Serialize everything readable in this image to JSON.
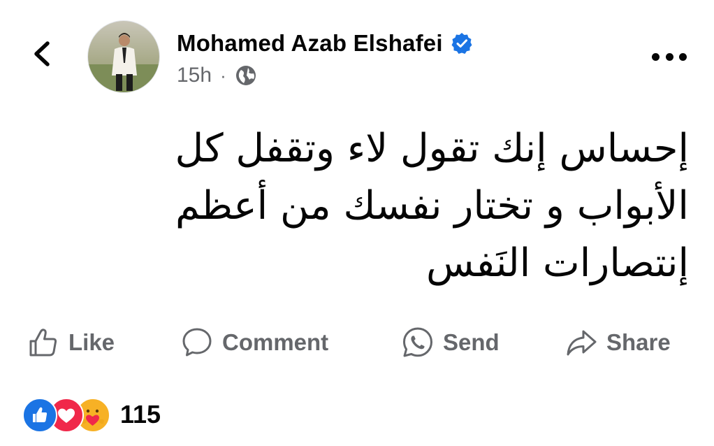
{
  "header": {
    "back_icon": "chevron-left-icon",
    "author_name": "Mohamed Azab Elshafei",
    "verified_icon": "verified-badge-icon",
    "time": "15h",
    "separator": "·",
    "privacy_icon": "globe-icon",
    "more_icon": "more-horizontal-icon"
  },
  "post": {
    "lines": [
      "إحساس إنك تقول لاء وتقفل كل",
      "الأبواب و تختار نفسك من أعظم",
      "إنتصارات النَفس"
    ]
  },
  "actions": [
    {
      "label": "Like",
      "icon": "thumbs-up-icon"
    },
    {
      "label": "Comment",
      "icon": "comment-bubble-icon"
    },
    {
      "label": "Send",
      "icon": "whatsapp-icon"
    },
    {
      "label": "Share",
      "icon": "share-arrow-icon"
    }
  ],
  "reactions": {
    "icons": [
      "like-reaction-icon",
      "love-reaction-icon",
      "care-reaction-icon"
    ],
    "count": "115"
  },
  "colors": {
    "text": "#050505",
    "secondary": "#65676b",
    "facebook_blue": "#1b74e4",
    "love_red": "#f0284a",
    "care_yellow": "#f7b125"
  }
}
